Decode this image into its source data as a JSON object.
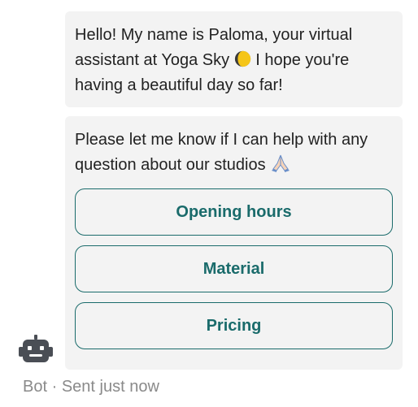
{
  "messages": [
    {
      "text_before_emoji": "Hello! My name is Paloma, your virtual assistant at Yoga Sky ",
      "emoji_icon": "first-quarter-moon-icon",
      "text_after_emoji": " I hope you're having a beautiful day so far!"
    },
    {
      "text_before_emoji": "Please let me know if I can help with any question about our studios ",
      "emoji_icon": "folded-hands-icon",
      "text_after_emoji": ""
    }
  ],
  "quick_replies": [
    {
      "label": "Opening hours"
    },
    {
      "label": "Material"
    },
    {
      "label": "Pricing"
    }
  ],
  "sender": {
    "avatar_icon": "robot-icon",
    "name": "Bot",
    "separator": "·",
    "status": "Sent just now"
  },
  "colors": {
    "bubble_background": "#f3f3f3",
    "accent": "#1a6b6b",
    "text": "#222222",
    "meta_text": "#8a8a8a",
    "avatar": "#4a4e55"
  }
}
